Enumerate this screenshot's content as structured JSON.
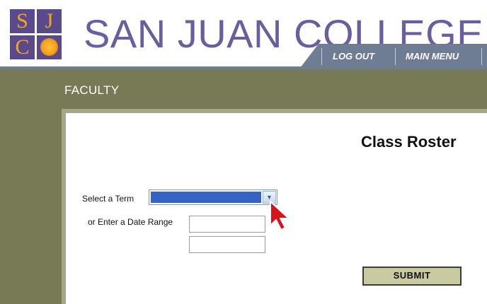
{
  "header": {
    "logo": {
      "letters": [
        "S",
        "J",
        "C"
      ]
    },
    "college_name": "SAN JUAN COLLEGE",
    "tabs": [
      {
        "label": "LOG OUT"
      },
      {
        "label": "MAIN MENU"
      }
    ]
  },
  "section": {
    "title": "FACULTY"
  },
  "form": {
    "title": "Class Roster",
    "term_label": "Select a Term",
    "term_selected": "",
    "date_range_label": "or Enter a Date Range",
    "date_start": "",
    "date_end": "",
    "submit_label": "SUBMIT"
  },
  "colors": {
    "brand_purple": "#5a4a8c",
    "brand_gold": "#f2a81d",
    "tab_bar": "#6f7d94",
    "olive_band": "#787a56",
    "submit_bg": "#c9c9a2",
    "select_highlight": "#3462c6"
  },
  "icons": {
    "dropdown": "chevron-down-icon",
    "pointer": "mouse-pointer-icon"
  }
}
